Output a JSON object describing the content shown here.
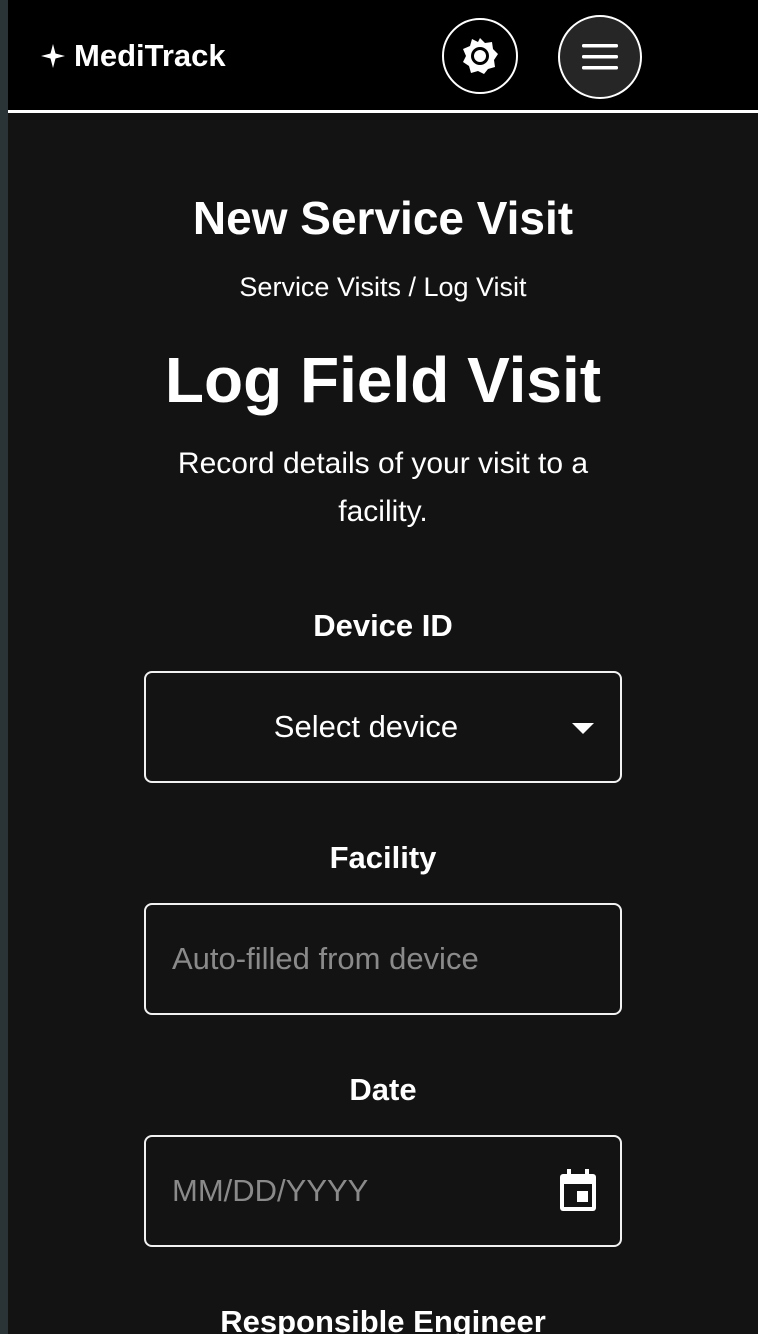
{
  "header": {
    "brand": "MediTrack",
    "brand_icon": "sparkle-icon",
    "theme_icon": "brightness-icon",
    "menu_icon": "hamburger-menu-icon"
  },
  "page": {
    "heading": "New Service Visit",
    "breadcrumb": "Service Visits / Log Visit",
    "title": "Log Field Visit",
    "description": "Record details of your visit to a facility."
  },
  "form": {
    "device": {
      "label": "Device ID",
      "selected": "Select device"
    },
    "facility": {
      "label": "Facility",
      "placeholder": "Auto-filled from device"
    },
    "date": {
      "label": "Date",
      "placeholder": "MM/DD/YYYY",
      "icon": "calendar-icon"
    },
    "engineer": {
      "label": "Responsible Engineer"
    }
  },
  "colors": {
    "background": "#131313",
    "header": "#000000",
    "text": "#ffffff",
    "placeholder": "#8a8a8a"
  }
}
